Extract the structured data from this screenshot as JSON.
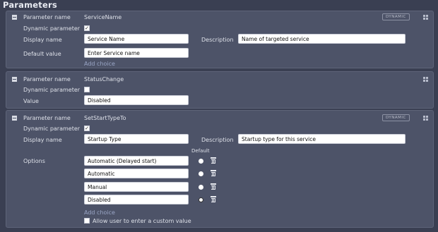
{
  "page": {
    "title": "Parameters"
  },
  "labels": {
    "parameter_name": "Parameter name",
    "dynamic_parameter": "Dynamic parameter",
    "display_name": "Display name",
    "description": "Description",
    "default_value": "Default value",
    "value": "Value",
    "options": "Options",
    "default": "Default",
    "add_choice": "Add choice",
    "dynamic_badge": "DYNAMIC"
  },
  "params": [
    {
      "name": "ServiceName",
      "dynamic": true,
      "display_name": "Service Name",
      "description": "Name of targeted service",
      "default_value": "Enter Service name"
    },
    {
      "name": "StatusChange",
      "dynamic": false,
      "value": "Disabled"
    },
    {
      "name": "SetStartTypeTo",
      "dynamic": true,
      "display_name": "Startup Type",
      "description": "Startup type for this service",
      "options": [
        "Automatic (Delayed start)",
        "Automatic",
        "Manual",
        "Disabled"
      ],
      "default_index": 3,
      "allow_custom_label": "Allow user to enter a custom value",
      "allow_custom": false
    }
  ]
}
